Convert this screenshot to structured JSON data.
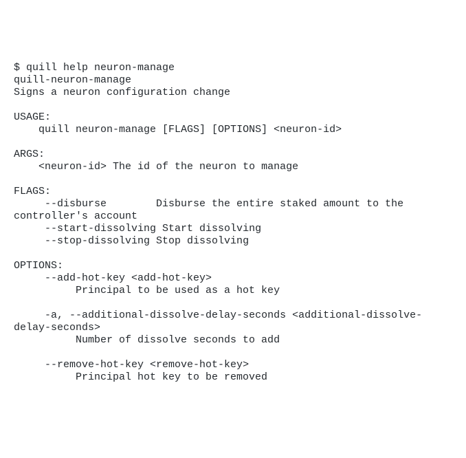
{
  "terminal": {
    "command_line": "$ quill help neuron-manage",
    "program": "quill-neuron-manage",
    "description": "Signs a neuron configuration change",
    "usage_header": "USAGE:",
    "usage_line": "    quill neuron-manage [FLAGS] [OPTIONS] <neuron-id>",
    "args_header": "ARGS:",
    "args_line": "    <neuron-id> The id of the neuron to manage",
    "flags_header": "FLAGS:",
    "flag_disburse": "     --disburse        Disburse the entire staked amount to the controller's account",
    "flag_start": "     --start-dissolving Start dissolving",
    "flag_stop": "     --stop-dissolving Stop dissolving",
    "options_header": "OPTIONS:",
    "opt_add_hot_key": "     --add-hot-key <add-hot-key>",
    "opt_add_hot_key_desc": "          Principal to be used as a hot key",
    "opt_delay": "     -a, --additional-dissolve-delay-seconds <additional-dissolve-delay-seconds>",
    "opt_delay_desc": "          Number of dissolve seconds to add",
    "opt_remove_hot_key": "     --remove-hot-key <remove-hot-key>",
    "opt_remove_hot_key_desc": "          Principal hot key to be removed"
  }
}
